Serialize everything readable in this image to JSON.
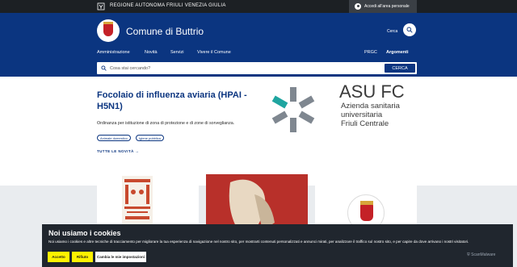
{
  "topbar": {
    "region_name": "REGIONE AUTONOMA FRIULI VENEZIA GIULIA",
    "login_label": "Accedi all'area personale"
  },
  "header": {
    "title": "Comune di Buttrio",
    "search_label": "Cerca",
    "nav": [
      "Amministrazione",
      "Novità",
      "Servizi",
      "Vivere il Comune"
    ],
    "nav_right": [
      "PRGC",
      "Argomenti"
    ]
  },
  "search": {
    "placeholder": "Cosa stai cercando?",
    "button": "CERCA"
  },
  "hero": {
    "title": "Focolaio di influenza aviaria (HPAI - H5N1)",
    "description": "Ordinanza per istituzione di zona di protezione e di zone di sorveglianza.",
    "tags": [
      "Animale domestico",
      "Igiene pubblica"
    ],
    "all_news": "TUTTE LE NOVITÀ"
  },
  "asu": {
    "big": "ASU FC",
    "lines": [
      "Azienda sanitaria",
      "universitaria",
      "Friuli Centrale"
    ]
  },
  "cookie": {
    "title": "Noi usiamo i cookies",
    "text": "Noi usiamo i cookies e altre tecniche di tracciamento per migliorare la tua esperienza di navigazione nel nostro sito, per mostrarti contenuti personalizzati e annunci mirati, per analizzare il traffico sul nostro sito, e per capire da dove arrivano i nostri visitatori.",
    "accept": "Accetto",
    "reject": "Rifiuto",
    "settings": "Cambia le mie impostazioni",
    "brand": "ScanMalware"
  },
  "colors": {
    "brand_blue": "#0b3580",
    "topbar": "#1c2024",
    "cookie_bg": "#20262e",
    "cookie_accent": "#fff200"
  }
}
